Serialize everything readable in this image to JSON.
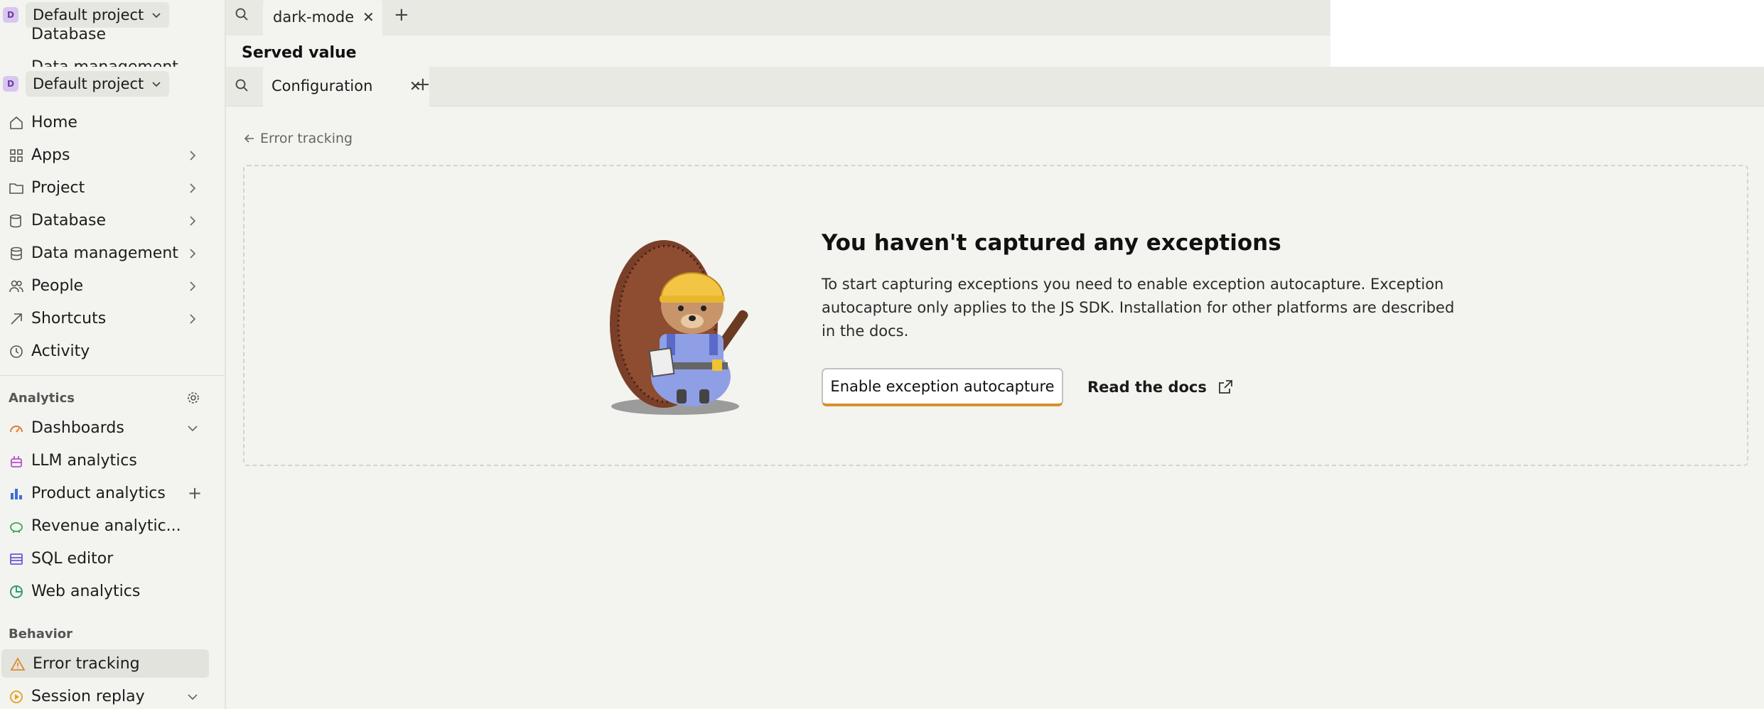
{
  "ghost_window": {
    "project_name": "Default project",
    "project_initial": "D",
    "peek_items": [
      "Database",
      "Data management"
    ],
    "tab_label": "dark-mode",
    "heading": "Served value"
  },
  "sidebar": {
    "project_name": "Default project",
    "project_initial": "D",
    "items": [
      {
        "label": "Home",
        "icon": "home-icon"
      },
      {
        "label": "Apps",
        "icon": "apps-icon"
      },
      {
        "label": "Project",
        "icon": "folder-icon"
      },
      {
        "label": "Database",
        "icon": "database-icon"
      },
      {
        "label": "Data management",
        "icon": "data-icon"
      },
      {
        "label": "People",
        "icon": "people-icon"
      },
      {
        "label": "Shortcuts",
        "icon": "shortcut-icon"
      },
      {
        "label": "Activity",
        "icon": "clock-icon"
      }
    ],
    "analytics_title": "Analytics",
    "analytics_items": [
      {
        "label": "Dashboards",
        "icon": "dashboard-icon"
      },
      {
        "label": "LLM analytics",
        "icon": "llm-icon"
      },
      {
        "label": "Product analytics",
        "icon": "bar-chart-icon"
      },
      {
        "label": "Revenue analytic...",
        "icon": "piggy-bank-icon"
      },
      {
        "label": "SQL editor",
        "icon": "sql-icon"
      },
      {
        "label": "Web analytics",
        "icon": "pie-icon"
      }
    ],
    "behavior_title": "Behavior",
    "behavior_items": [
      {
        "label": "Error tracking",
        "icon": "warning-icon"
      },
      {
        "label": "Session replay",
        "icon": "replay-icon"
      }
    ]
  },
  "tabs": {
    "active_label": "Configuration"
  },
  "main": {
    "back_label": "Error tracking",
    "empty_title": "You haven't captured any exceptions",
    "empty_description": "To start capturing exceptions you need to enable exception autocapture. Exception autocapture only applies to the JS SDK. Installation for other platforms are described in the docs.",
    "enable_button": "Enable exception autocapture",
    "docs_link": "Read the docs"
  },
  "colors": {
    "accent": "#d98f2b",
    "background": "#f3f3ef",
    "active_item": "#e3e3de"
  }
}
